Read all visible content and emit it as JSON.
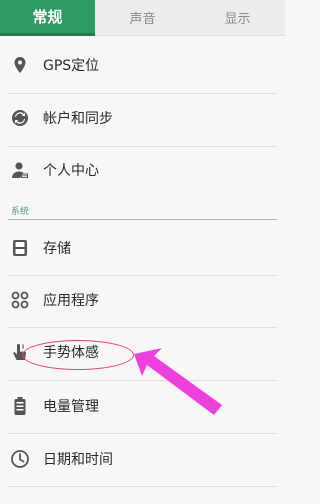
{
  "tabs": [
    {
      "label": "常规",
      "active": true
    },
    {
      "label": "声音",
      "active": false
    },
    {
      "label": "显示",
      "active": false
    }
  ],
  "general_items": [
    {
      "label": "GPS定位",
      "icon": "location-pin-icon"
    },
    {
      "label": "帐户和同步",
      "icon": "sync-icon"
    },
    {
      "label": "个人中心",
      "icon": "person-icon"
    }
  ],
  "system_section": {
    "title": "系统"
  },
  "system_items": [
    {
      "label": "存储",
      "icon": "storage-icon"
    },
    {
      "label": "应用程序",
      "icon": "apps-icon"
    },
    {
      "label": "手势体感",
      "icon": "gesture-icon"
    },
    {
      "label": "电量管理",
      "icon": "battery-icon"
    },
    {
      "label": "日期和时间",
      "icon": "clock-icon"
    }
  ],
  "colors": {
    "accent": "#2f9b63",
    "annotation": "#e0457a",
    "arrow": "#f03fe0"
  }
}
